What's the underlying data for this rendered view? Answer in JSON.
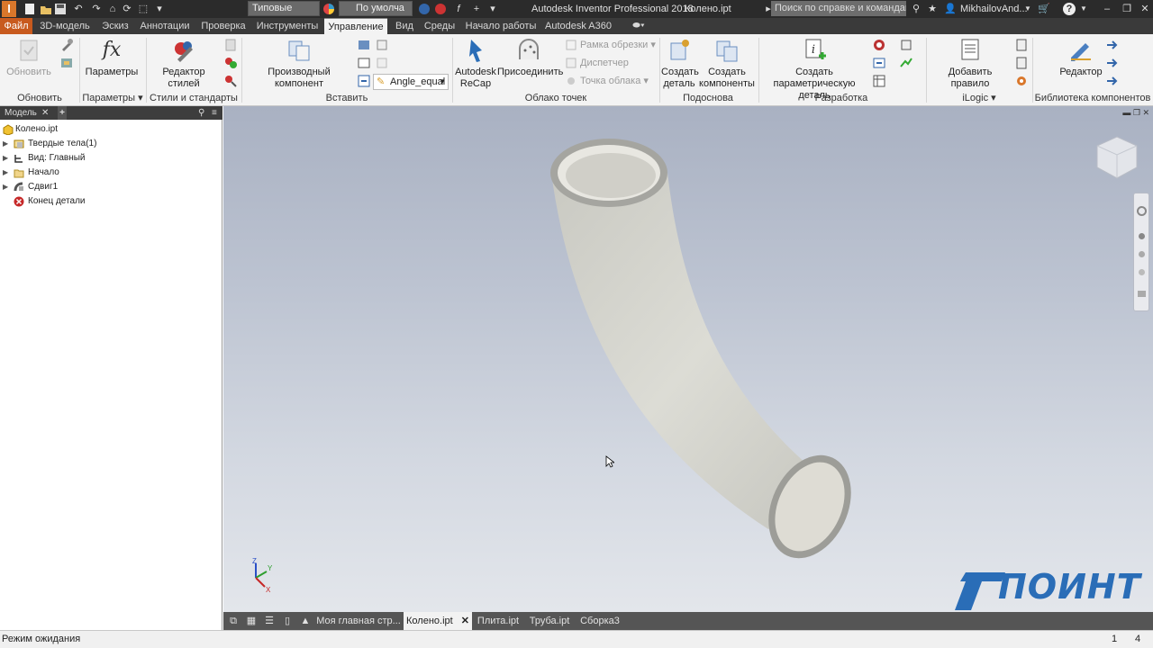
{
  "titlebar": {
    "app_title": "Autodesk Inventor Professional 2018",
    "doc_title": "Колено.ipt",
    "material_value": "Типовые",
    "appearance_value": "По умолча",
    "search_placeholder": "Поиск по справке и командам",
    "user_name": "MikhailovAnd...",
    "help_icon": "?"
  },
  "ribbon_tabs": [
    "Файл",
    "3D-модель",
    "Эскиз",
    "Аннотации",
    "Проверка",
    "Инструменты",
    "Управление",
    "Вид",
    "Среды",
    "Начало работы",
    "Autodesk A360"
  ],
  "active_tab": "Управление",
  "ribbon": {
    "update": {
      "label": "Обновить",
      "group": "Обновить"
    },
    "params": {
      "label": "Параметры",
      "group": "Параметры",
      "glyph": "fx"
    },
    "style_editor": {
      "label": "Редактор стилей",
      "group": "Стили и стандарты"
    },
    "derive": {
      "label": "Производный компонент",
      "dropdown_value": "Angle_equal",
      "group": "Вставить"
    },
    "recap": {
      "label1": "Autodesk",
      "label2": "ReCap"
    },
    "attach": {
      "label": "Присоединить"
    },
    "pointcloud": {
      "crop": "Рамка обрезки",
      "manager": "Диспетчер",
      "point": "Точка облака",
      "group": "Облако точек"
    },
    "substitute": {
      "create_part1": "Создать",
      "create_part2": "деталь",
      "create_comp1": "Создать",
      "create_comp2": "компоненты",
      "group": "Подоснова"
    },
    "author": {
      "label1": "Создать",
      "label2": "параметрическую деталь",
      "group": "Разработка"
    },
    "ilogic": {
      "add_rule": "Добавить правило",
      "group": "iLogic"
    },
    "content": {
      "editor": "Редактор",
      "group": "Библиотека компонентов"
    }
  },
  "browser": {
    "tab_label": "Модель",
    "tree": [
      {
        "label": "Колено.ipt",
        "icon": "part-icon",
        "expandable": false
      },
      {
        "label": "Твердые тела(1)",
        "icon": "solid-bodies-icon",
        "expandable": true
      },
      {
        "label": "Вид: Главный",
        "icon": "view-icon",
        "expandable": true
      },
      {
        "label": "Начало",
        "icon": "folder-icon",
        "expandable": true
      },
      {
        "label": "Сдвиг1",
        "icon": "sweep-icon",
        "expandable": true
      },
      {
        "label": "Конец детали",
        "icon": "end-of-part-icon",
        "expandable": false
      }
    ]
  },
  "viewport": {
    "triad": {
      "x": "X",
      "y": "Y",
      "z": "Z"
    },
    "watermark": "ПОИНТ",
    "accent_blue": "#2a6db7"
  },
  "doc_tabs": [
    {
      "label": "Моя главная стр...",
      "active": false
    },
    {
      "label": "Колено.ipt",
      "active": true
    },
    {
      "label": "Плита.ipt",
      "active": false
    },
    {
      "label": "Труба.ipt",
      "active": false
    },
    {
      "label": "Сборка3",
      "active": false
    }
  ],
  "status": {
    "text": "Режим ожидания",
    "count1": "1",
    "count2": "4"
  }
}
